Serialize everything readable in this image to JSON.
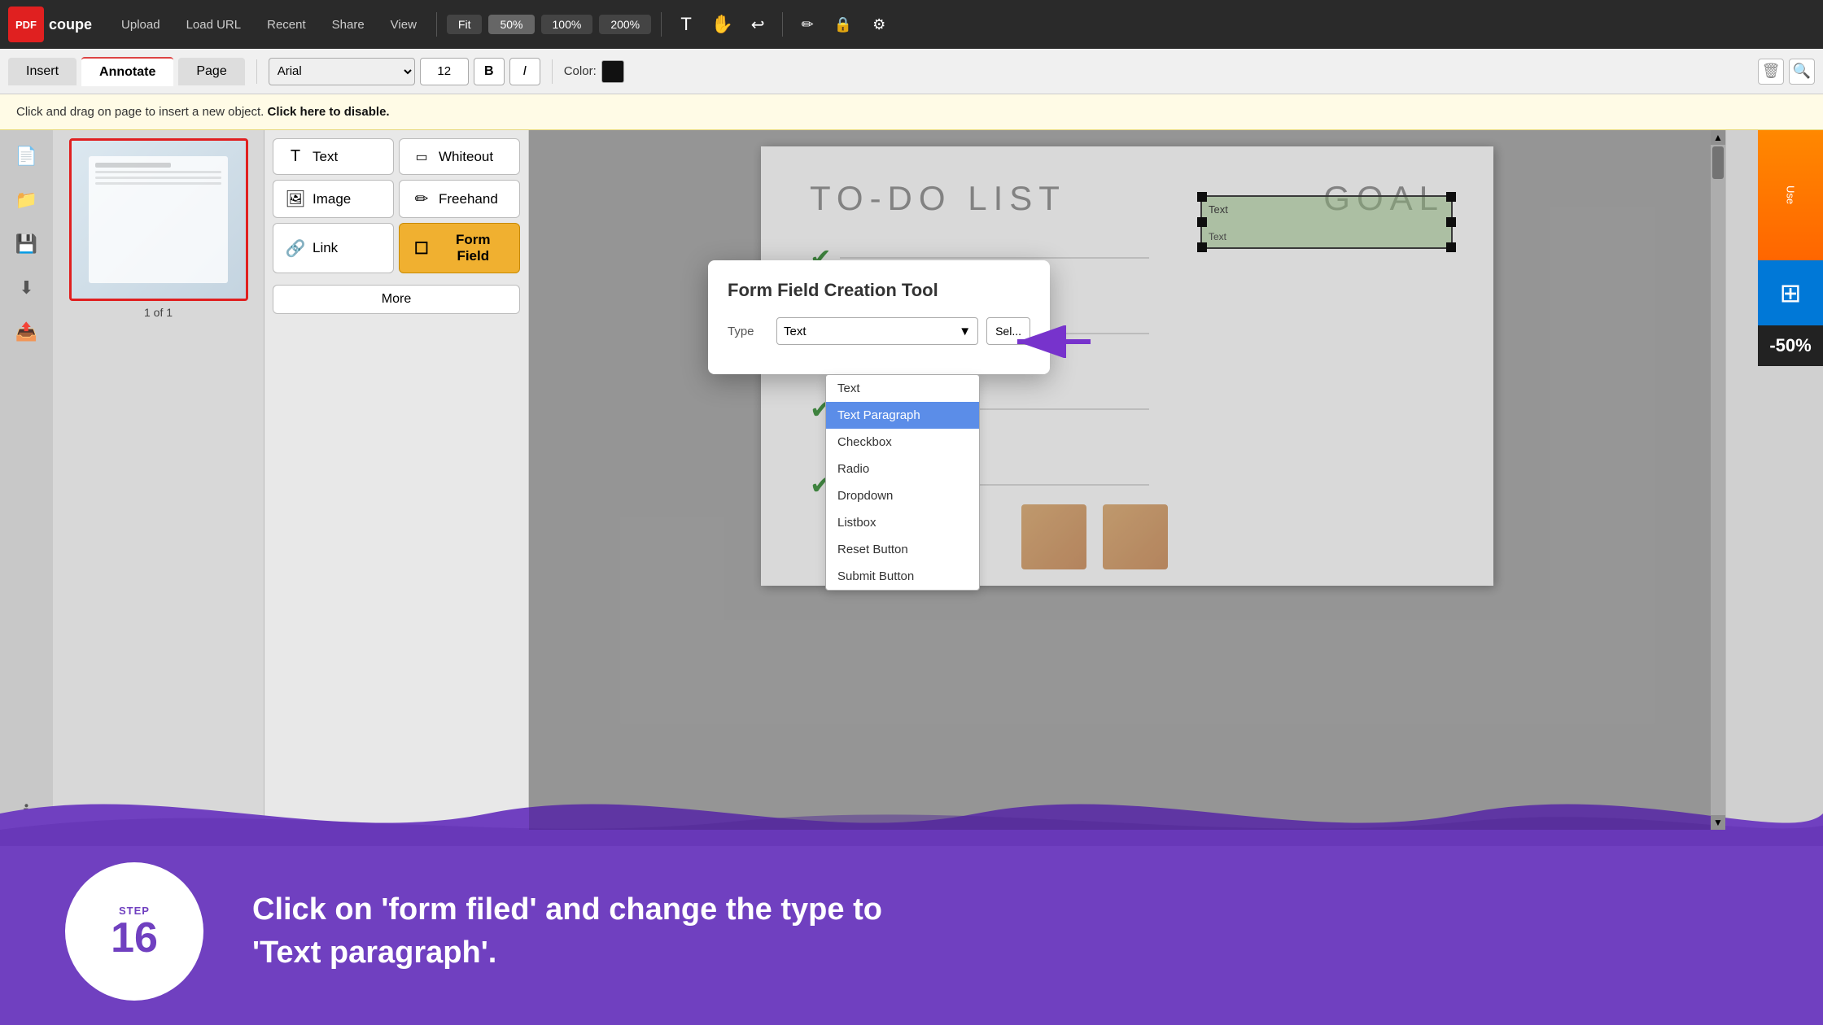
{
  "app": {
    "logo": "PDF",
    "logo_subtitle": "coupe"
  },
  "top_toolbar": {
    "buttons": [
      "Upload",
      "Load URL",
      "Recent",
      "Share",
      "View"
    ],
    "zoom_options": [
      "Fit",
      "50%",
      "100%",
      "200%"
    ],
    "active_zoom": "50%"
  },
  "secondary_toolbar": {
    "tabs": [
      "Insert",
      "Annotate",
      "Page"
    ],
    "active_tab": "Annotate",
    "font": "Arial",
    "font_size": "12",
    "bold_label": "B",
    "italic_label": "I",
    "color_label": "Color:"
  },
  "notification_bar": {
    "text": "Click and drag on page to insert a new object.",
    "cta": "Click here to disable."
  },
  "left_panel": {
    "tools": [
      {
        "id": "text",
        "label": "Text",
        "icon": "T"
      },
      {
        "id": "whiteout",
        "label": "Whiteout",
        "icon": "W"
      },
      {
        "id": "image",
        "label": "Image",
        "icon": "I"
      },
      {
        "id": "freehand",
        "label": "Freehand",
        "icon": "F"
      },
      {
        "id": "link",
        "label": "Link",
        "icon": "L"
      },
      {
        "id": "form-field",
        "label": "Form Field",
        "icon": "FF"
      }
    ],
    "more_button": "More",
    "active_tool": "form-field"
  },
  "thumbnail": {
    "page_counter": "1 of 1"
  },
  "pdf_content": {
    "todo_title": "TO-DO LIST",
    "goal_title": "GOAL",
    "text_items": [
      "Text",
      "Text"
    ]
  },
  "modal": {
    "title": "Form Field Creation Tool",
    "type_label": "Type",
    "current_type": "Text",
    "dropdown_items": [
      {
        "id": "text",
        "label": "Text",
        "selected": false
      },
      {
        "id": "text-paragraph",
        "label": "Text Paragraph",
        "selected": true
      },
      {
        "id": "checkbox",
        "label": "Checkbox",
        "selected": false
      },
      {
        "id": "radio",
        "label": "Radio",
        "selected": false
      },
      {
        "id": "dropdown",
        "label": "Dropdown",
        "selected": false
      },
      {
        "id": "listbox",
        "label": "Listbox",
        "selected": false
      },
      {
        "id": "reset-button",
        "label": "Reset Button",
        "selected": false
      },
      {
        "id": "submit-button",
        "label": "Submit Button",
        "selected": false
      }
    ],
    "select_btn_label": "Sel..."
  },
  "right_panel": {
    "use_text": "Use",
    "windows_icon": "⊞",
    "discount_label": "-50%"
  },
  "bottom_section": {
    "step_label": "Step",
    "step_number": "16",
    "instruction_line1": "Click on 'form filed' and change the type to",
    "instruction_line2": "'Text paragraph'."
  }
}
